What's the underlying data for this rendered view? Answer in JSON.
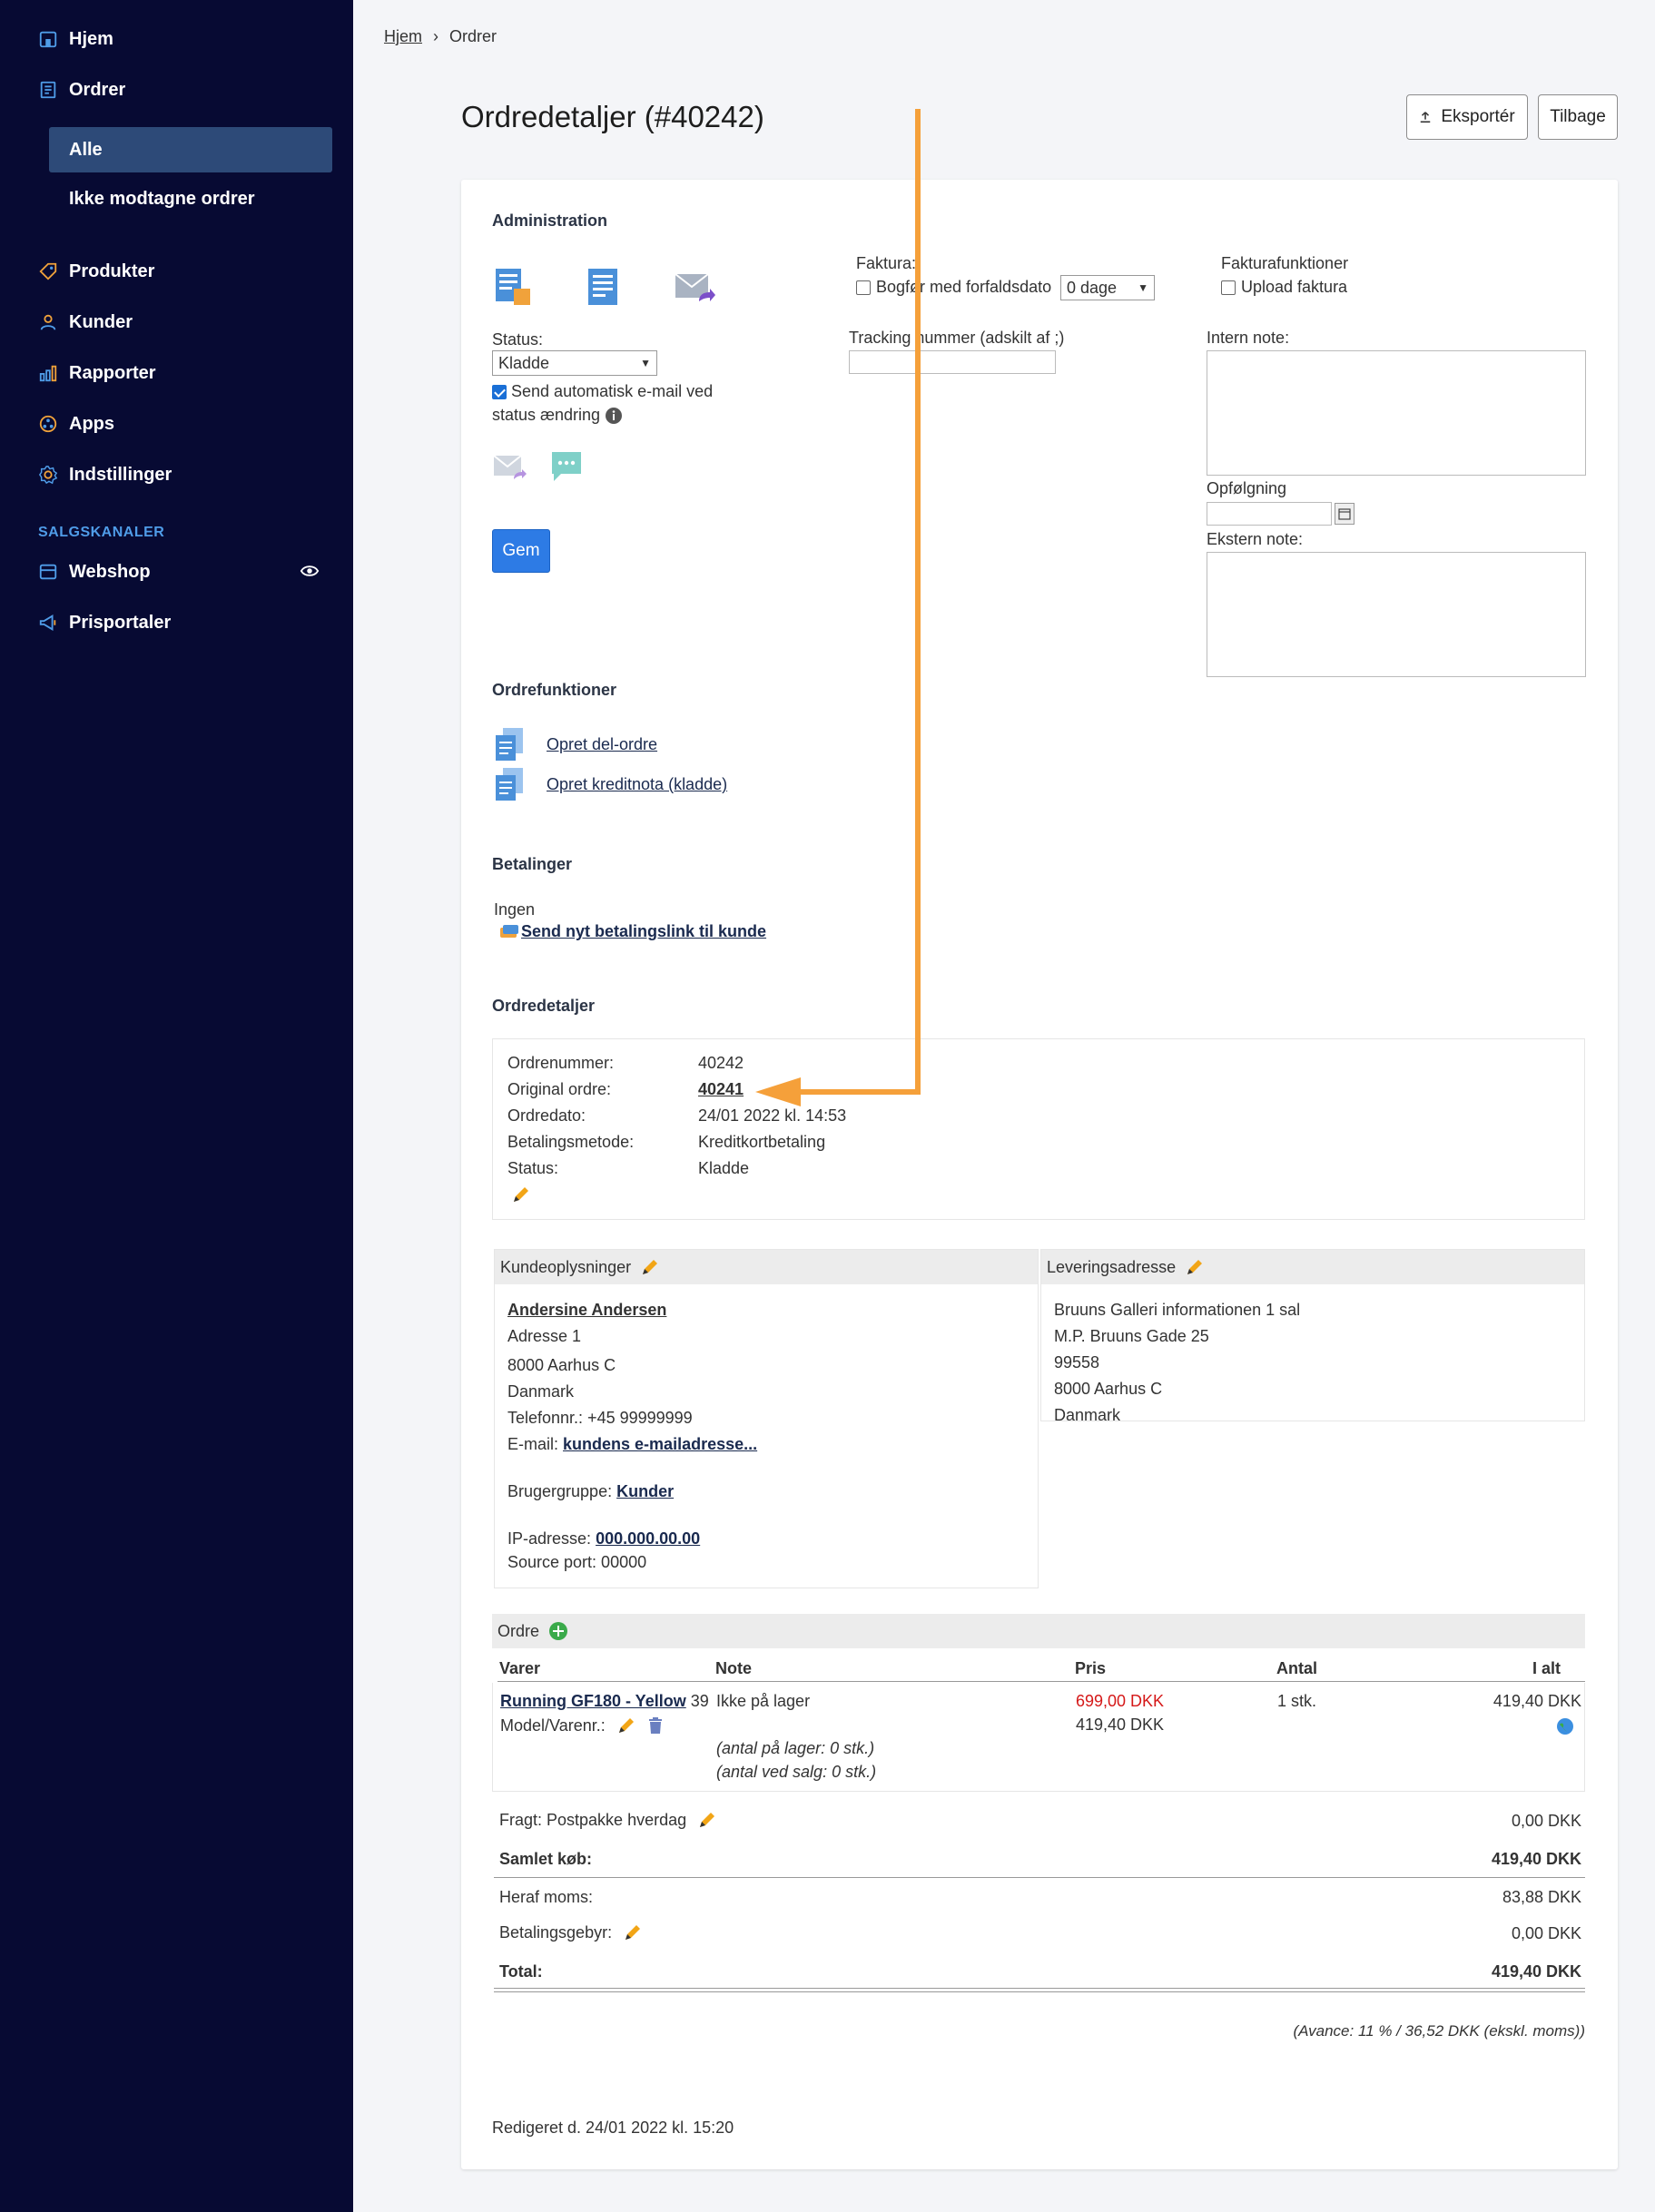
{
  "sidebar": {
    "items": [
      {
        "label": "Hjem",
        "icon": "home-icon"
      },
      {
        "label": "Ordrer",
        "icon": "orders-icon"
      },
      {
        "label": "Produkter",
        "icon": "tag-icon"
      },
      {
        "label": "Kunder",
        "icon": "user-icon"
      },
      {
        "label": "Rapporter",
        "icon": "chart-icon"
      },
      {
        "label": "Apps",
        "icon": "apps-icon"
      },
      {
        "label": "Indstillinger",
        "icon": "gear-icon"
      }
    ],
    "sub_items": {
      "active": "Alle",
      "other": "Ikke modtagne ordrer"
    },
    "section_label": "SALGSKANALER",
    "channels": [
      {
        "label": "Webshop",
        "icon": "store-icon"
      },
      {
        "label": "Prisportaler",
        "icon": "megaphone-icon"
      }
    ]
  },
  "breadcrumb": {
    "home": "Hjem",
    "separator": "›",
    "current": "Ordrer"
  },
  "header": {
    "title": "Ordredetaljer (#40242)",
    "export_label": "Eksportér",
    "back_label": "Tilbage"
  },
  "administration": {
    "title": "Administration",
    "status_label": "Status:",
    "status_value": "Kladde",
    "auto_email_label_1": "Send automatisk e-mail ved",
    "auto_email_label_2": "status ændring",
    "save_label": "Gem",
    "faktura_label": "Faktura:",
    "bogfor_label": "Bogfør med forfaldsdato",
    "due_days_value": "0 dage",
    "tracking_label": "Tracking nummer (adskilt af ;)",
    "fakturafunktioner_label": "Fakturafunktioner",
    "upload_faktura_label": "Upload faktura",
    "intern_note_label": "Intern note:",
    "opfolgning_label": "Opfølgning",
    "ekstern_note_label": "Ekstern note:"
  },
  "ordrefunktioner": {
    "title": "Ordrefunktioner",
    "create_sub_order": "Opret del-ordre",
    "create_credit_note": "Opret kreditnota (kladde)"
  },
  "betalinger": {
    "title": "Betalinger",
    "none_label": "Ingen",
    "send_link_label": "Send nyt betalingslink til kunde"
  },
  "ordredetaljer": {
    "title": "Ordredetaljer",
    "rows": [
      {
        "label": "Ordrenummer:",
        "value": "40242"
      },
      {
        "label": "Original ordre:",
        "value": "40241"
      },
      {
        "label": "Ordredato:",
        "value": "24/01 2022 kl. 14:53"
      },
      {
        "label": "Betalingsmetode:",
        "value": "Kreditkortbetaling"
      },
      {
        "label": "Status:",
        "value": "Kladde"
      }
    ]
  },
  "kunde": {
    "title": "Kundeoplysninger",
    "name": "Andersine Andersen",
    "address": "Adresse 1",
    "city": "8000 Aarhus C",
    "country": "Danmark",
    "phone": "Telefonnr.: +45 99999999",
    "email_label": "E-mail:",
    "email_link": "kundens e-mailadresse...",
    "group_label": "Brugergruppe:",
    "group_link": "Kunder",
    "ip_label": "IP-adresse:",
    "ip_link": "000.000.00.00",
    "source_port": "Source port: 00000"
  },
  "levering": {
    "title": "Leveringsadresse",
    "lines": [
      "Bruuns Galleri informationen 1 sal",
      "M.P. Bruuns Gade 25",
      "99558",
      "8000 Aarhus C",
      "Danmark"
    ]
  },
  "ordre": {
    "title": "Ordre",
    "columns": {
      "varer": "Varer",
      "note": "Note",
      "pris": "Pris",
      "antal": "Antal",
      "ialt": "I alt"
    },
    "item": {
      "name_link": "Running GF180 - Yellow",
      "name_suffix": "39",
      "model_label": "Model/Varenr.:",
      "note": "Ikke på lager",
      "stock_note_1": "(antal på lager: 0 stk.)",
      "stock_note_2": "(antal ved salg: 0 stk.)",
      "price_original": "699,00 DKK",
      "price_discounted": "419,40 DKK",
      "quantity": "1 stk.",
      "total": "419,40 DKK"
    },
    "fragt_label": "Fragt: Postpakke hverdag",
    "fragt_value": "0,00 DKK",
    "samlet_label": "Samlet køb:",
    "samlet_value": "419,40 DKK",
    "moms_label": "Heraf moms:",
    "moms_value": "83,88 DKK",
    "gebyr_label": "Betalingsgebyr:",
    "gebyr_value": "0,00 DKK",
    "total_label": "Total:",
    "total_value": "419,40 DKK",
    "avance": "(Avance: 11 % / 36,52 DKK (ekskl. moms))"
  },
  "edited": "Redigeret d. 24/01 2022 kl. 15:20",
  "colors": {
    "sidebar_bg": "#070a33",
    "primary": "#2d7be5",
    "annotation_arrow": "#f5a03a",
    "pencil": "#f2a516"
  }
}
